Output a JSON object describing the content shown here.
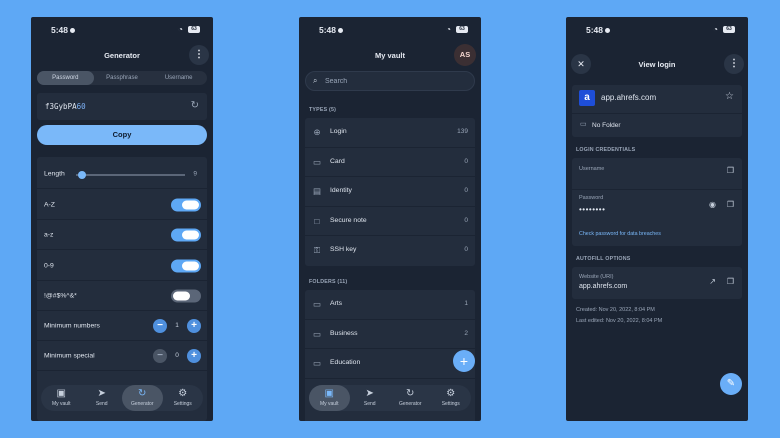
{
  "generator": {
    "status_time": "5:48",
    "battery": "63",
    "title": "Generator",
    "tabs": [
      {
        "label": "Password",
        "active": true
      },
      {
        "label": "Passphrase",
        "active": false
      },
      {
        "label": "Username",
        "active": false
      }
    ],
    "password_letters": "f3GybPA",
    "password_digits": "60",
    "copy_label": "Copy",
    "length_label": "Length",
    "length_value": "9",
    "toggles": [
      {
        "label": "A-Z",
        "on": true
      },
      {
        "label": "a-z",
        "on": true
      },
      {
        "label": "0-9",
        "on": true
      },
      {
        "label": "!@#$%^&*",
        "on": false
      }
    ],
    "min_numbers_label": "Minimum numbers",
    "min_numbers_value": "1",
    "min_special_label": "Minimum special",
    "min_special_value": "0"
  },
  "vault": {
    "status_time": "5:48",
    "battery": "63",
    "title": "My vault",
    "avatar_initials": "AS",
    "search_placeholder": "Search",
    "types_header": "TYPES (5)",
    "types": [
      {
        "label": "Login",
        "count": "139",
        "icon": "globe-icon"
      },
      {
        "label": "Card",
        "count": "0",
        "icon": "card-icon"
      },
      {
        "label": "Identity",
        "count": "0",
        "icon": "id-icon"
      },
      {
        "label": "Secure note",
        "count": "0",
        "icon": "note-icon"
      },
      {
        "label": "SSH key",
        "count": "0",
        "icon": "key-icon"
      }
    ],
    "folders_header": "FOLDERS (11)",
    "folders": [
      {
        "label": "Arts",
        "count": "1"
      },
      {
        "label": "Business",
        "count": "2"
      },
      {
        "label": "Education",
        "count": ""
      }
    ]
  },
  "nav": [
    {
      "label": "My vault",
      "icon": "vault-icon"
    },
    {
      "label": "Send",
      "icon": "send-icon"
    },
    {
      "label": "Generator",
      "icon": "generator-icon"
    },
    {
      "label": "Settings",
      "icon": "gear-icon"
    }
  ],
  "login": {
    "status_time": "5:48",
    "battery": "63",
    "title": "View login",
    "item_name": "app.ahrefs.com",
    "logo_letter": "a",
    "folder": "No Folder",
    "credentials_header": "LOGIN CREDENTIALS",
    "username_label": "Username",
    "password_label": "Password",
    "password_masked": "••••••••",
    "breach_link": "Check password for data breaches",
    "autofill_header": "AUTOFILL OPTIONS",
    "website_label": "Website (URI)",
    "website_value": "app.ahrefs.com",
    "created": "Created: Nov 20, 2022, 8:04 PM",
    "last_edited": "Last edited: Nov 20, 2022, 8:04 PM"
  },
  "colors": {
    "background": "#5ea8f5",
    "panel": "#1b2433",
    "accent": "#7ab8f9"
  }
}
